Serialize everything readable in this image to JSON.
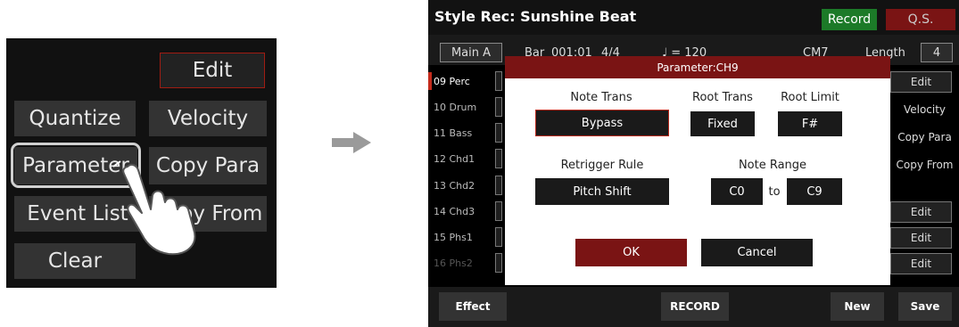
{
  "left_menu": {
    "edit": "Edit",
    "quantize": "Quantize",
    "velocity": "Velocity",
    "parameter": "Parameter",
    "copy_para": "Copy Para",
    "event_list": "Event List",
    "copy_from": "Copy From",
    "clear": "Clear"
  },
  "screen": {
    "title": "Style Rec: Sunshine Beat",
    "tabs": {
      "record": "Record",
      "qs": "Q.S."
    },
    "info": {
      "section": "Main A",
      "bar_label": "Bar",
      "bar_value": "001:01",
      "time_sig": "4/4",
      "tempo_label": "♩ = 120",
      "chord": "CM7",
      "length_label": "Length",
      "length_value": "4"
    },
    "tracks": [
      {
        "label": "09 Perc"
      },
      {
        "label": "10 Drum"
      },
      {
        "label": "11 Bass"
      },
      {
        "label": "12 Chd1"
      },
      {
        "label": "13 Chd2"
      },
      {
        "label": "14 Chd3"
      },
      {
        "label": "15 Phs1"
      },
      {
        "label": "16 Phs2"
      }
    ],
    "side_buttons": {
      "edit": "Edit",
      "velocity": "Velocity",
      "copy_para": "Copy Para",
      "copy_from": "Copy From"
    },
    "bottom": {
      "effect": "Effect",
      "record": "RECORD",
      "new": "New",
      "save": "Save"
    },
    "colors": {
      "accent_red": "#7a1414",
      "record_green": "#1c7a28",
      "highlight_red": "#c42b1c"
    }
  },
  "dialog": {
    "title": "Parameter:CH9",
    "note_trans_label": "Note Trans",
    "note_trans_value": "Bypass",
    "root_trans_label": "Root Trans",
    "root_trans_value": "Fixed",
    "root_limit_label": "Root Limit",
    "root_limit_value": "F#",
    "retrigger_label": "Retrigger Rule",
    "retrigger_value": "Pitch Shift",
    "note_range_label": "Note Range",
    "range_low": "C0",
    "range_to": "to",
    "range_high": "C9",
    "ok": "OK",
    "cancel": "Cancel"
  },
  "icons": [
    "pointing-hand-icon",
    "right-arrow-icon"
  ]
}
